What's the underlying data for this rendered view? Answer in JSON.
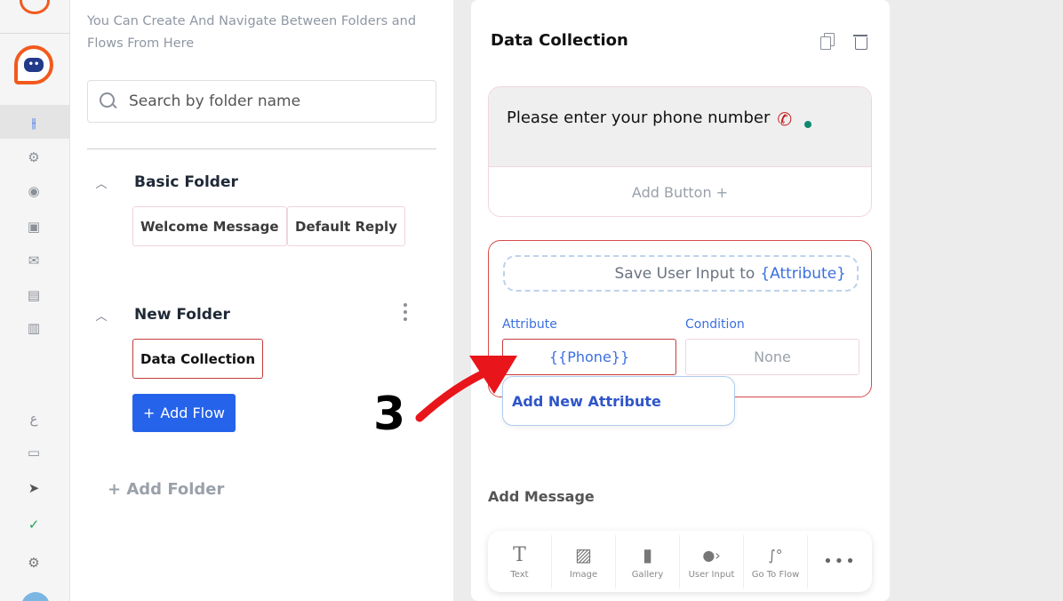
{
  "panel": {
    "intro": "You Can Create And Navigate Between Folders and Flows From Here",
    "search_placeholder": "Search by folder name",
    "folders": [
      {
        "name": "Basic Folder",
        "flows": [
          "Welcome Message",
          "Default Reply"
        ]
      },
      {
        "name": "New Folder",
        "flows": [
          "Data Collection"
        ]
      }
    ],
    "add_flow_label": "Add Flow",
    "add_flow_plus": "+",
    "add_folder_label": "+ Add Folder"
  },
  "editor": {
    "title": "Data Collection",
    "message_text": "Please enter your phone number",
    "add_button_label": "Add Button +",
    "save_input_prefix": "Save User Input to",
    "save_input_attr": "{Attribute}",
    "attribute_label": "Attribute",
    "condition_label": "Condition",
    "attribute_value": "{{Phone}}",
    "condition_value": "None",
    "dropdown_option": "Add New Attribute",
    "add_message_label": "Add Message",
    "tools": [
      {
        "icon": "text-icon",
        "label": "Text"
      },
      {
        "icon": "image-icon",
        "label": "Image"
      },
      {
        "icon": "gallery-icon",
        "label": "Gallery"
      },
      {
        "icon": "user-input-icon",
        "label": "User Input"
      },
      {
        "icon": "go-to-flow-icon",
        "label": "Go To Flow"
      },
      {
        "icon": "more-icon",
        "label": ""
      }
    ]
  },
  "annotation": {
    "step_number": "3",
    "arrow_color": "#e8151b"
  },
  "colors": {
    "brand_orange": "#f25a1d",
    "primary_blue": "#2563eb",
    "selected_border": "#c53b3b"
  }
}
